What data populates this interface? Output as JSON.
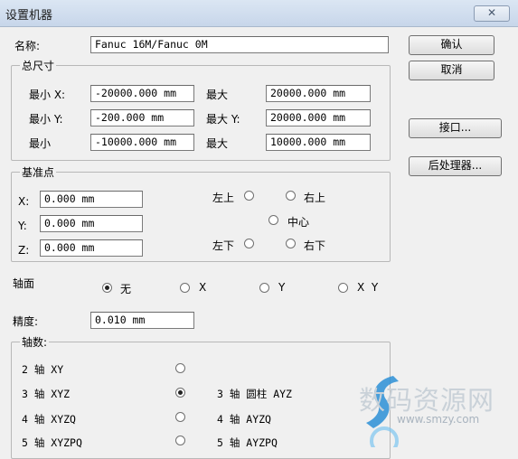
{
  "window": {
    "title": "设置机器",
    "close_label": "✕"
  },
  "name_field": {
    "label": "名称:",
    "value": "Fanuc 16M/Fanuc 0M"
  },
  "buttons": {
    "ok": "确认",
    "cancel": "取消",
    "interface": "接口...",
    "postprocessor": "后处理器..."
  },
  "total_size": {
    "legend": "总尺寸",
    "rows": [
      {
        "min_label": "最小 X:",
        "min_value": "-20000.000 mm",
        "max_label": "最大",
        "max_value": "20000.000 mm"
      },
      {
        "min_label": "最小 Y:",
        "min_value": "-200.000 mm",
        "max_label": "最大 Y:",
        "max_value": "20000.000 mm"
      },
      {
        "min_label": "最小",
        "min_value": "-10000.000 mm",
        "max_label": "最大",
        "max_value": "10000.000 mm"
      }
    ]
  },
  "reference_point": {
    "legend": "基准点",
    "x_label": "X:",
    "x_value": "0.000 mm",
    "y_label": "Y:",
    "y_value": "0.000 mm",
    "z_label": "Z:",
    "z_value": "0.000 mm",
    "options": {
      "top_left": "左上",
      "top_right": "右上",
      "center": "中心",
      "bottom_left": "左下",
      "bottom_right": "右下"
    }
  },
  "axis_plane": {
    "label": "轴面",
    "options": [
      "无",
      "X",
      "Y",
      "X  Y"
    ],
    "selected": "无"
  },
  "precision": {
    "label": "精度:",
    "value": "0.010 mm"
  },
  "axis_count": {
    "legend": "轴数:",
    "left": [
      "2 轴 XY",
      "3 轴 XYZ",
      "4 轴 XYZQ",
      "5 轴 XYZPQ"
    ],
    "right": [
      "3 轴 圆柱 AYZ",
      "4 轴 AYZQ",
      "5 轴 AYZPQ"
    ],
    "selected": "3 轴 XYZ"
  },
  "watermark": {
    "text": "数码资源网",
    "url": "www.smzy.com"
  }
}
